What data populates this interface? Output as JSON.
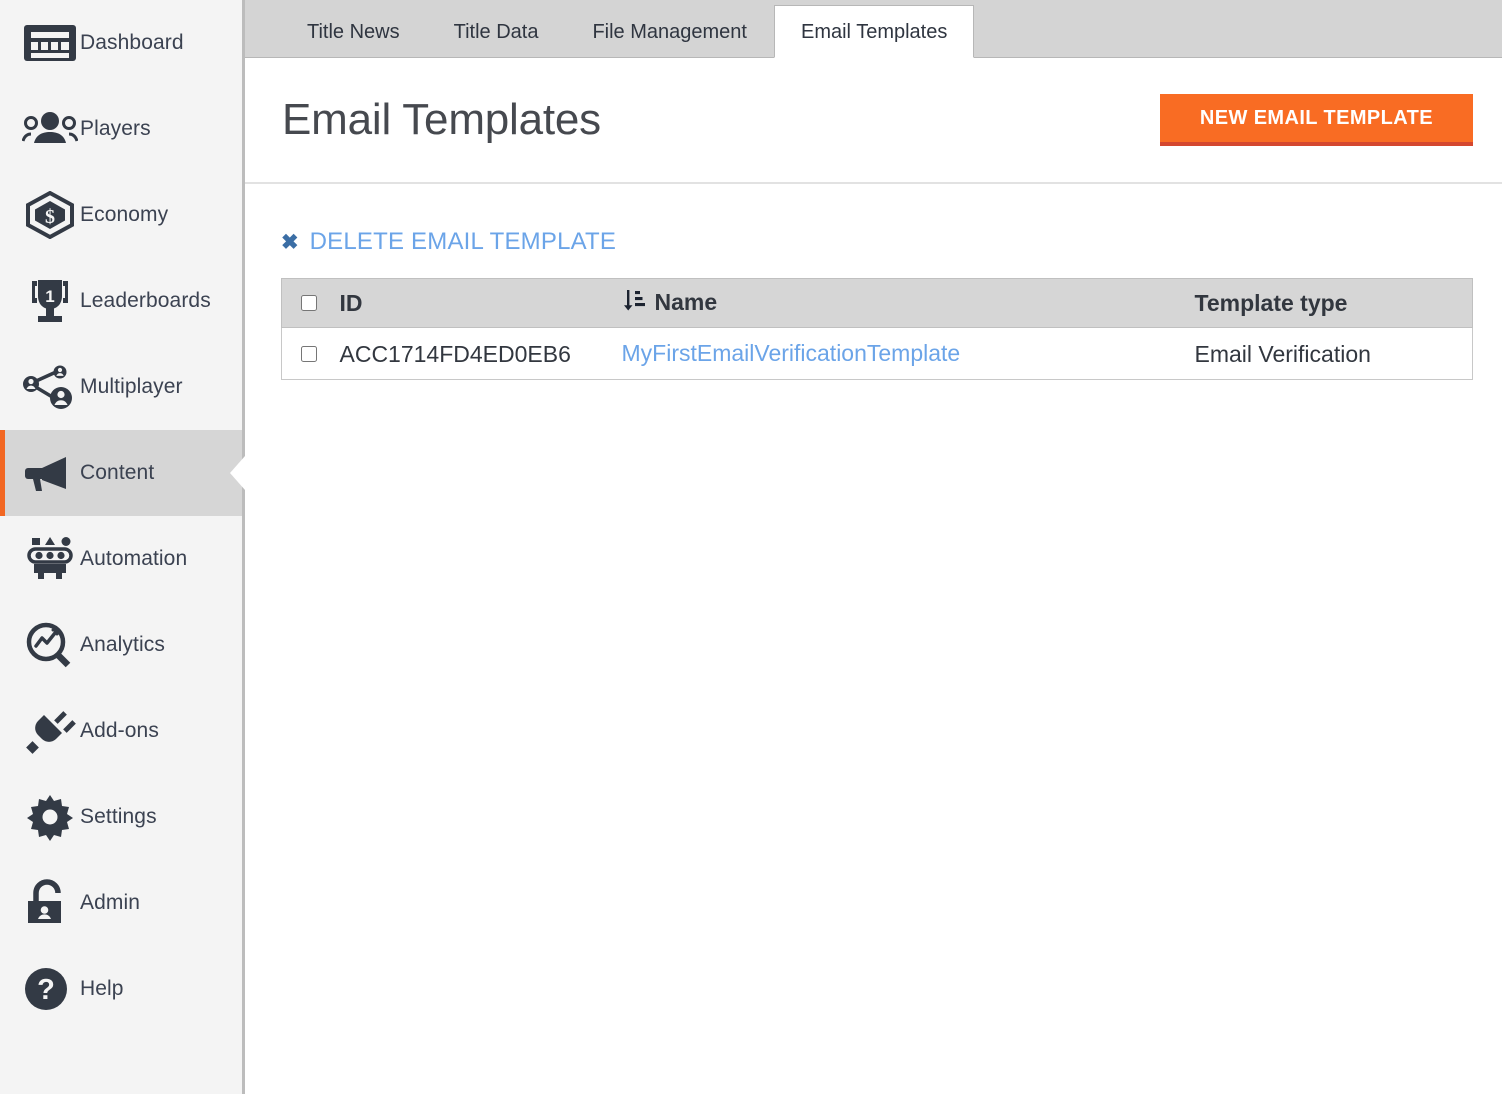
{
  "sidebar": {
    "items": [
      {
        "label": "Dashboard",
        "icon": "dashboard-icon",
        "active": false
      },
      {
        "label": "Players",
        "icon": "players-icon",
        "active": false
      },
      {
        "label": "Economy",
        "icon": "economy-icon",
        "active": false
      },
      {
        "label": "Leaderboards",
        "icon": "leaderboards-icon",
        "active": false
      },
      {
        "label": "Multiplayer",
        "icon": "multiplayer-icon",
        "active": false
      },
      {
        "label": "Content",
        "icon": "content-icon",
        "active": true
      },
      {
        "label": "Automation",
        "icon": "automation-icon",
        "active": false
      },
      {
        "label": "Analytics",
        "icon": "analytics-icon",
        "active": false
      },
      {
        "label": "Add-ons",
        "icon": "addons-icon",
        "active": false
      },
      {
        "label": "Settings",
        "icon": "settings-icon",
        "active": false
      },
      {
        "label": "Admin",
        "icon": "admin-icon",
        "active": false
      },
      {
        "label": "Help",
        "icon": "help-icon",
        "active": false
      }
    ],
    "accent_color": "#f26722",
    "active_bg": "#d6d6d6"
  },
  "tabs": [
    {
      "label": "Title News",
      "active": false
    },
    {
      "label": "Title Data",
      "active": false
    },
    {
      "label": "File Management",
      "active": false
    },
    {
      "label": "Email Templates",
      "active": true
    }
  ],
  "header": {
    "title": "Email Templates",
    "new_button_label": "NEW EMAIL TEMPLATE",
    "new_button_color": "#f96c23",
    "new_button_border_color": "#d4472f"
  },
  "actions": {
    "delete_label": "DELETE EMAIL TEMPLATE",
    "delete_icon": "close-x-icon",
    "link_color": "#6ba4e8"
  },
  "table": {
    "sort_icon": "sort-amount-asc-icon",
    "sorted_column": "Name",
    "columns": [
      {
        "key": "select",
        "label": ""
      },
      {
        "key": "id",
        "label": "ID"
      },
      {
        "key": "name",
        "label": "Name"
      },
      {
        "key": "type",
        "label": "Template type"
      }
    ],
    "rows": [
      {
        "selected": false,
        "id": "ACC1714FD4ED0EB6",
        "name": "MyFirstEmailVerificationTemplate",
        "type": "Email Verification"
      }
    ]
  }
}
